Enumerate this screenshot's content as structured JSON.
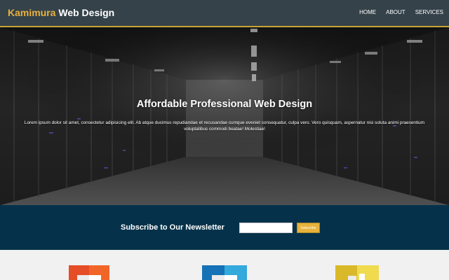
{
  "header": {
    "brand_highlight": "Kamimura",
    "brand_rest": " Web Design",
    "nav": [
      {
        "label": "HOME"
      },
      {
        "label": "ABOUT"
      },
      {
        "label": "SERVICES"
      }
    ]
  },
  "hero": {
    "title": "Affordable Professional Web Design",
    "body": "Lorem ipsum dolor sit amet, consectetur adipisicing elit. Ab atque ducimus repudiandae et recusandae cumque eveniet consequatur, culpa vero. Vero quisquam, aspernatur nisi soluta animi praesentium voluptatibus commodi beatae! Molestiae!"
  },
  "newsletter": {
    "title": "Subscribe to Our Newsletter",
    "input_value": "",
    "button_label": "Subscribe"
  },
  "boxes": {
    "badges": [
      {
        "icon": "html5-logo-icon",
        "color": "#e44d26"
      },
      {
        "icon": "css3-logo-icon",
        "color": "#1572b6"
      },
      {
        "icon": "js-logo-icon",
        "color": "#d9b92a"
      }
    ]
  },
  "colors": {
    "header_bg": "#35424a",
    "accent": "#e8b23b",
    "newsletter_bg": "#05324a",
    "boxes_bg": "#f1f1f1"
  }
}
